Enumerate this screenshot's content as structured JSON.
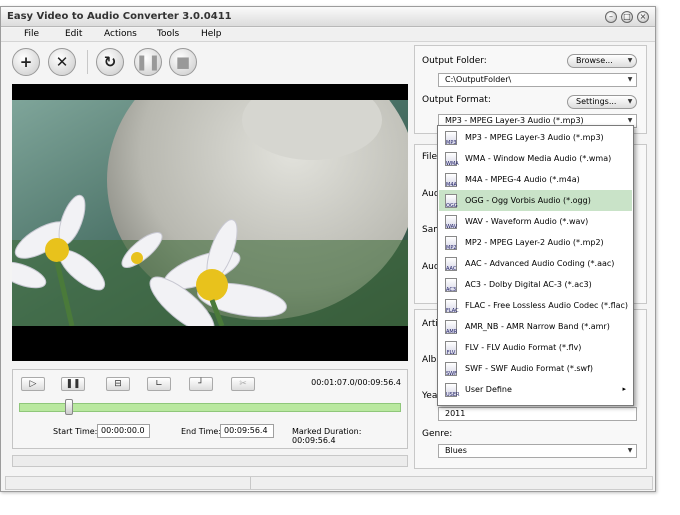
{
  "window": {
    "title": "Easy Video to Audio Converter 3.0.0411"
  },
  "menu": [
    "File",
    "Edit",
    "Actions",
    "Tools",
    "Help"
  ],
  "toolbar": {
    "add_icon": "plus",
    "remove_icon": "x",
    "convert_icon": "refresh",
    "pause_icon": "pause",
    "stop_icon": "stop"
  },
  "player": {
    "timecode": "00:01:07.0/00:09:56.4",
    "progress": 0.13,
    "start_time_label": "Start Time:",
    "start_time": "00:00:00.0",
    "end_time_label": "End Time:",
    "end_time": "00:09:56.4",
    "marked_duration": "Marked Duration: 00:09:56.4"
  },
  "output": {
    "folder_label": "Output Folder:",
    "browse": "Browse...",
    "folder": "C:\\OutputFolder\\",
    "format_label": "Output Format:",
    "settings": "Settings...",
    "format": "MP3 - MPEG Layer-3 Audio (*.mp3)"
  },
  "partial_labels": {
    "file": "File I",
    "audio1": "Audi",
    "sample": "Sam",
    "audio2": "Audi",
    "artist": "Artis",
    "album": "Albu",
    "year": "Year"
  },
  "tags": {
    "year": "2011",
    "genre_label": "Genre:",
    "genre": "Blues"
  },
  "formats": [
    {
      "label": "MP3 - MPEG Layer-3 Audio (*.mp3)",
      "icon": "MP3"
    },
    {
      "label": "WMA - Window Media Audio (*.wma)",
      "icon": "WMA"
    },
    {
      "label": "M4A - MPEG-4 Audio (*.m4a)",
      "icon": "M4A"
    },
    {
      "label": "OGG - Ogg Vorbis Audio (*.ogg)",
      "icon": "OGG"
    },
    {
      "label": "WAV - Waveform Audio (*.wav)",
      "icon": "WAV"
    },
    {
      "label": "MP2 - MPEG Layer-2 Audio (*.mp2)",
      "icon": "MP2"
    },
    {
      "label": "AAC - Advanced Audio Coding (*.aac)",
      "icon": "AAC"
    },
    {
      "label": "AC3 - Dolby Digital AC-3 (*.ac3)",
      "icon": "AC3"
    },
    {
      "label": "FLAC - Free Lossless Audio Codec (*.flac)",
      "icon": "FLAC"
    },
    {
      "label": "AMR_NB - AMR Narrow Band (*.amr)",
      "icon": "AMR"
    },
    {
      "label": "FLV - FLV Audio Format (*.flv)",
      "icon": "FLV"
    },
    {
      "label": "SWF - SWF Audio Format (*.swf)",
      "icon": "SWF"
    },
    {
      "label": "User Define",
      "icon": "USER",
      "submenu": "▸"
    }
  ]
}
